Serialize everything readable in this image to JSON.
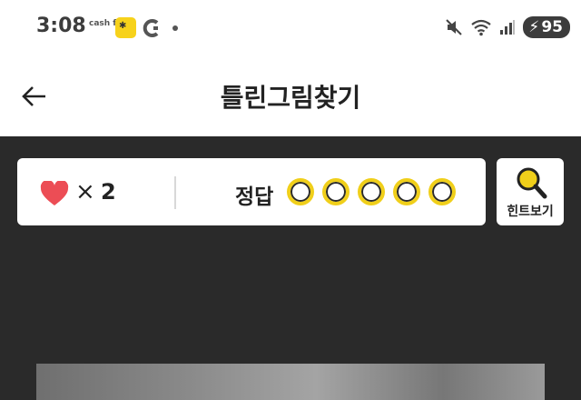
{
  "status_bar": {
    "time": "3:08",
    "cash_label": "cash feed",
    "battery_level": "95"
  },
  "header": {
    "title": "틀린그림찾기"
  },
  "game_info": {
    "lives_multiplier": "×",
    "lives_count": "2",
    "answer_label": "정답",
    "answer_slots_total": 5,
    "answer_slots_found": 0
  },
  "hint": {
    "label": "힌트보기"
  },
  "colors": {
    "heart": "#ec4d55",
    "accent_yellow": "#f0cf1a",
    "background_dark": "#2a2a2a"
  }
}
